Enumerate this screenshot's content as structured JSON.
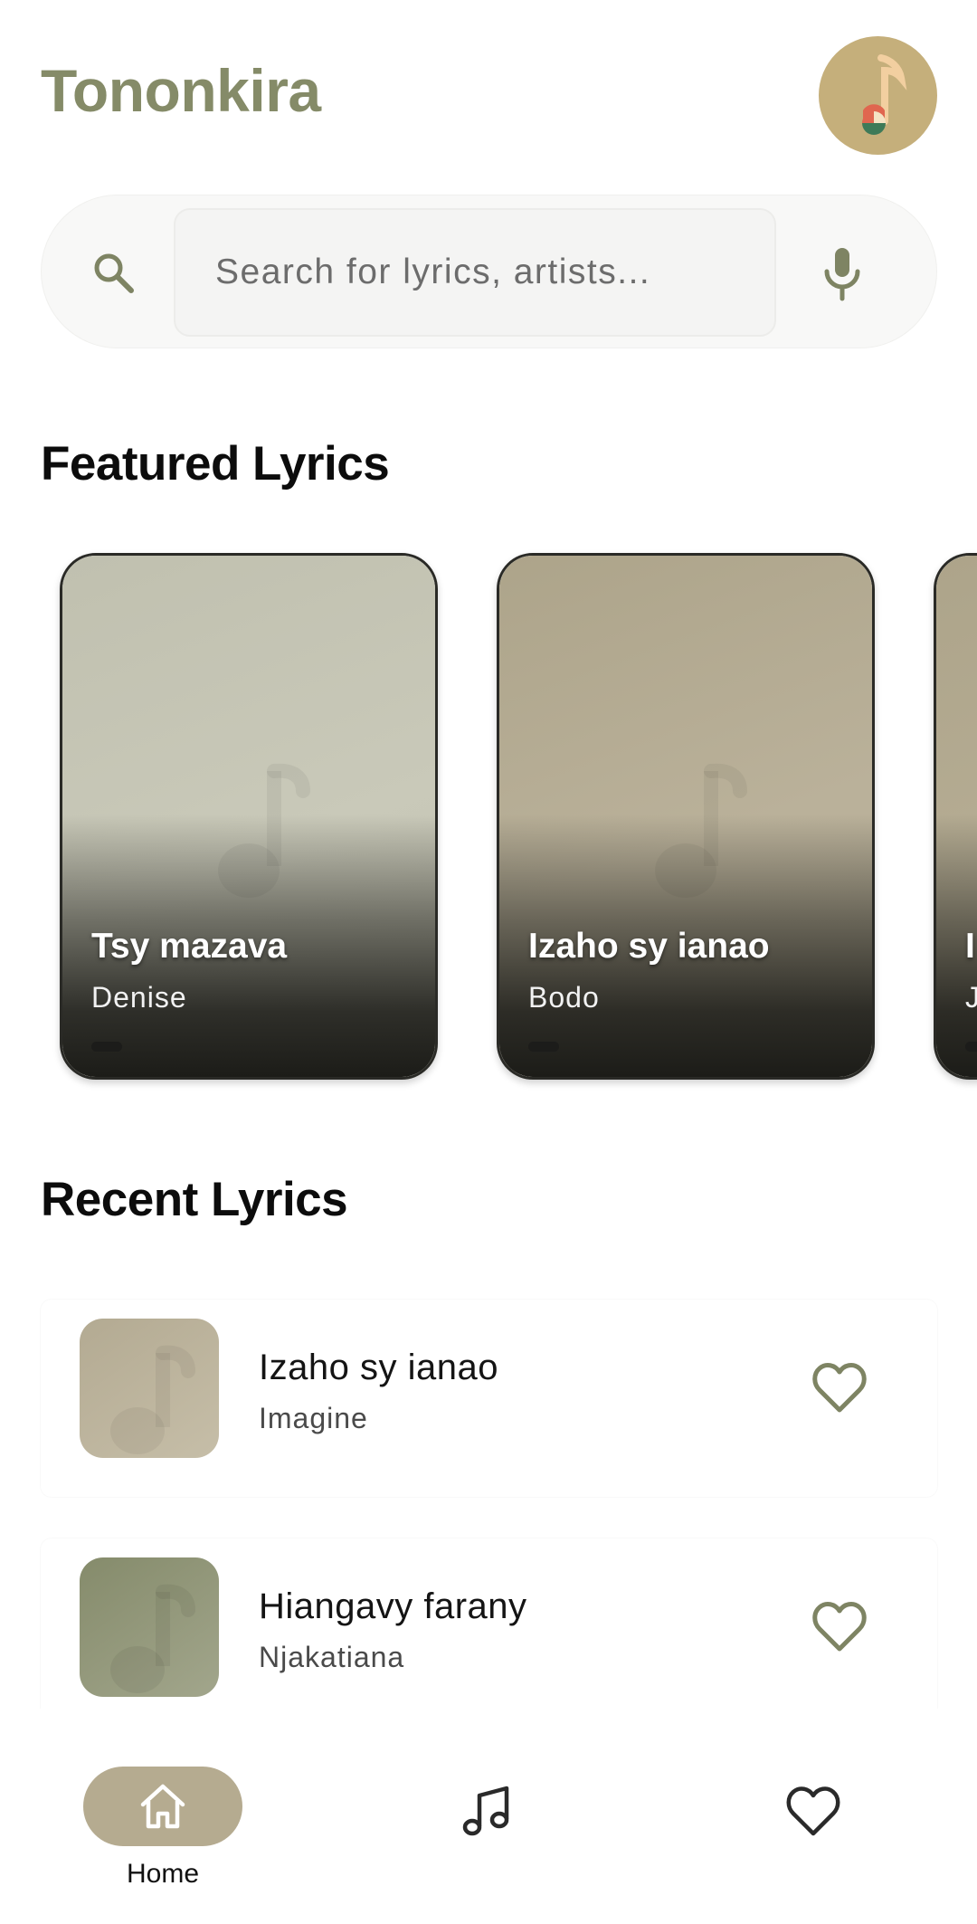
{
  "app": {
    "title": "Tononkira"
  },
  "search": {
    "placeholder": "Search for lyrics, artists..."
  },
  "featured": {
    "heading": "Featured Lyrics",
    "cards": [
      {
        "title": "Tsy mazava",
        "artist": "Denise"
      },
      {
        "title": "Izaho sy ianao",
        "artist": "Bodo"
      },
      {
        "title": "I",
        "artist": "J"
      }
    ]
  },
  "recent": {
    "heading": "Recent Lyrics",
    "items": [
      {
        "title": "Izaho sy ianao",
        "artist": "Imagine"
      },
      {
        "title": "Hiangavy farany",
        "artist": "Njakatiana"
      }
    ]
  },
  "nav": {
    "home_label": "Home"
  },
  "colors": {
    "accent": "#858B68",
    "avatar_bg": "#C5AF7B",
    "nav_pill": "#B5AB90",
    "card1": "#C3C3B3",
    "card2": "#B4AA92",
    "thumb1": "#BDB49D",
    "thumb2": "#8F9576"
  },
  "icons": {
    "avatar": "music-note-icon",
    "search": "search-icon",
    "mic": "mic-icon",
    "favorite": "heart-outline-icon",
    "nav_home": "home-icon",
    "nav_lyrics": "music-note-icon",
    "nav_favorites": "heart-outline-icon"
  }
}
